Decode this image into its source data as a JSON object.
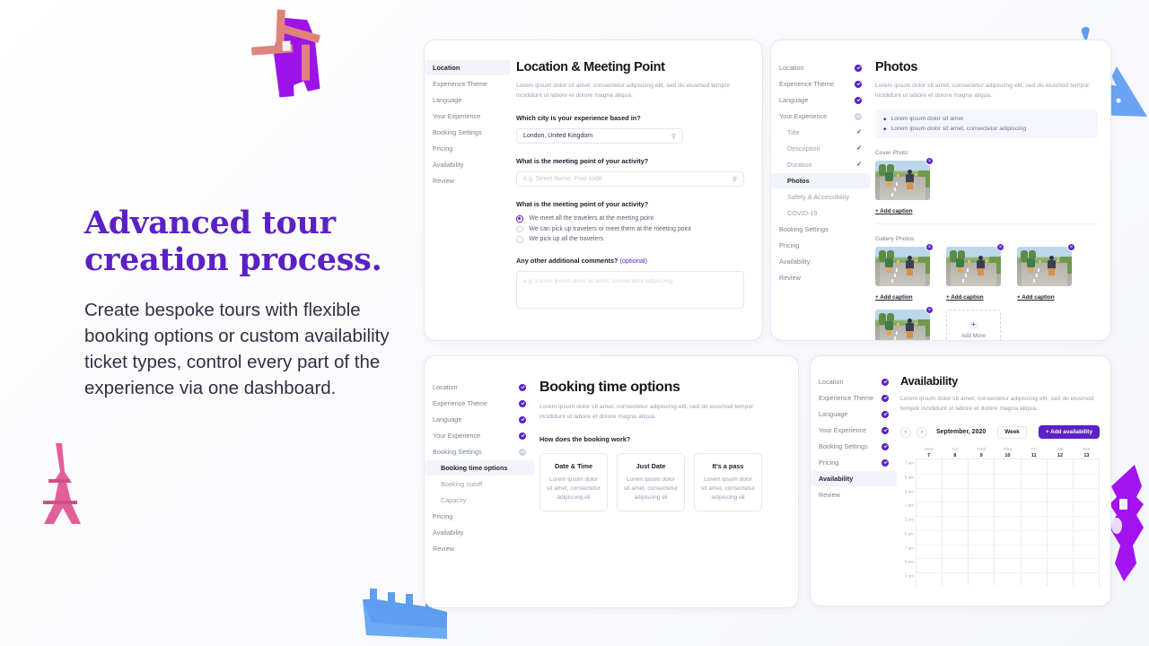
{
  "hero": {
    "headline_line1": "Advanced tour",
    "headline_line2": "creation process.",
    "body": "Create bespoke tours with flexible booking options or custom availability ticket types, control every part of the experience via one dashboard.",
    "headline_color": "#5b21c4"
  },
  "theme": {
    "accent": "#5b21c4",
    "nav_active_bg": "#f1f4fa",
    "card_border": "#e3e8f2"
  },
  "decor": [
    {
      "name": "windmill",
      "colors": [
        "#9b13e8",
        "#e0827e"
      ]
    },
    {
      "name": "eiffel-tower",
      "colors": [
        "#e0609a",
        "#c94f86"
      ]
    },
    {
      "name": "great-wall",
      "colors": [
        "#5d9ef0",
        "#79b4f7"
      ]
    },
    {
      "name": "pyramid",
      "colors": [
        "#6aa3f2"
      ]
    },
    {
      "name": "tower",
      "colors": [
        "#a312f0"
      ]
    },
    {
      "name": "map-pin",
      "colors": [
        "#5d9ef0"
      ]
    }
  ],
  "card_location": {
    "nav": [
      {
        "label": "Location",
        "state": "active"
      },
      {
        "label": "Experience Theme",
        "state": "idle"
      },
      {
        "label": "Language",
        "state": "idle"
      },
      {
        "label": "Your Experience",
        "state": "idle"
      },
      {
        "label": "Booking Settings",
        "state": "idle"
      },
      {
        "label": "Pricing",
        "state": "idle"
      },
      {
        "label": "Availability",
        "state": "idle"
      },
      {
        "label": "Review",
        "state": "idle"
      }
    ],
    "title": "Location & Meeting Point",
    "lede": "Lorem ipsum dolor sit amet, consectetur adipiscing elit, sed do eiusmod tempor incididunt ut labore et dolore magna aliqua.",
    "q_city": "Which city is your experience based in?",
    "city_value": "London, United Kingdom",
    "q_meeting_field": "What is the meeting point of your activity?",
    "meeting_placeholder": "e.g. Street Name, Post code",
    "q_meeting_radio": "What is the meeting point of your activity?",
    "radio_options": [
      {
        "label": "We meet all the travelers at the meeting point",
        "selected": true
      },
      {
        "label": "We can pick up travelers or meet them at the meeting point",
        "selected": false
      },
      {
        "label": "We pick up all the travelers",
        "selected": false
      }
    ],
    "q_comments": "Any other additional comments?",
    "q_comments_optional": "(optional)",
    "comments_placeholder": "e.g. Lorem ipsum dolor sit amet, consectetur adipiscing",
    "search_icon": "magnifier-icon"
  },
  "card_photos": {
    "nav": [
      {
        "label": "Location",
        "state": "done",
        "sub": false
      },
      {
        "label": "Experience Theme",
        "state": "done",
        "sub": false
      },
      {
        "label": "Language",
        "state": "done",
        "sub": false
      },
      {
        "label": "Your Experience",
        "state": "partial",
        "sub": false
      },
      {
        "label": "Title",
        "state": "tick",
        "sub": true
      },
      {
        "label": "Description",
        "state": "tick",
        "sub": true
      },
      {
        "label": "Duration",
        "state": "tick",
        "sub": true
      },
      {
        "label": "Photos",
        "state": "active",
        "sub": true
      },
      {
        "label": "Safety & Accessibility",
        "state": "idle",
        "sub": true
      },
      {
        "label": "COVID-19",
        "state": "idle",
        "sub": true
      },
      {
        "label": "Booking Settings",
        "state": "idle",
        "sub": false
      },
      {
        "label": "Pricing",
        "state": "idle",
        "sub": false
      },
      {
        "label": "Availability",
        "state": "idle",
        "sub": false
      },
      {
        "label": "Review",
        "state": "idle",
        "sub": false
      }
    ],
    "title": "Photos",
    "lede": "Lorem ipsum dolor sit amet, consectetur adipiscing elit, sed do eiusmod tempor incididunt ut labore et dolore magna aliqua.",
    "notes": [
      "Lorem ipsum dolor sit amet",
      "Lorem ipsum dolor sit amet, consectetur adipiscing"
    ],
    "cover_label": "Cover Photo",
    "gallery_label": "Gallery Photos",
    "add_caption": "+ Add caption",
    "add_more": "Add More",
    "add_more_plus": "+",
    "delete_badge": "×",
    "gallery_count": 4
  },
  "card_booking": {
    "nav": [
      {
        "label": "Location",
        "state": "done",
        "sub": false
      },
      {
        "label": "Experience Theme",
        "state": "done",
        "sub": false
      },
      {
        "label": "Language",
        "state": "done",
        "sub": false
      },
      {
        "label": "Your Experience",
        "state": "done",
        "sub": false
      },
      {
        "label": "Booking Settings",
        "state": "partial",
        "sub": false
      },
      {
        "label": "Booking time options",
        "state": "active",
        "sub": true
      },
      {
        "label": "Booking cutoff",
        "state": "idle",
        "sub": true
      },
      {
        "label": "Capacity",
        "state": "idle",
        "sub": true
      },
      {
        "label": "Pricing",
        "state": "idle",
        "sub": false
      },
      {
        "label": "Availability",
        "state": "idle",
        "sub": false
      },
      {
        "label": "Review",
        "state": "idle",
        "sub": false
      }
    ],
    "title": "Booking time options",
    "lede": "Lorem ipsum dolor sit amet, consectetur adipiscing elit, sed do eiusmod tempor incididunt ut labore et dolore magna aliqua.",
    "question": "How does the booking work?",
    "options": [
      {
        "title": "Date & Time",
        "desc": "Lorem ipsum dolor sit amet, consectetur adipiscing eli"
      },
      {
        "title": "Just Date",
        "desc": "Lorem ipsum dolor sit amet, consectetur adipiscing eli"
      },
      {
        "title": "It's a pass",
        "desc": "Lorem ipsum dolor sit amet, consectetur adipiscing eli"
      }
    ]
  },
  "card_availability": {
    "nav": [
      {
        "label": "Location",
        "state": "done",
        "sub": false
      },
      {
        "label": "Experience Theme",
        "state": "done",
        "sub": false
      },
      {
        "label": "Language",
        "state": "done",
        "sub": false
      },
      {
        "label": "Your Experience",
        "state": "done",
        "sub": false
      },
      {
        "label": "Booking Settings",
        "state": "done",
        "sub": false
      },
      {
        "label": "Pricing",
        "state": "done",
        "sub": false
      },
      {
        "label": "Availability",
        "state": "active",
        "sub": false
      },
      {
        "label": "Review",
        "state": "idle",
        "sub": false
      }
    ],
    "title": "Availability",
    "lede": "Lorem ipsum dolor sit amet, consectetur adipiscing elit, sed do eiusmod tempor incididunt ut labore et dolore magna aliqua.",
    "prev_icon": "‹",
    "next_icon": "›",
    "month": "September, 2020",
    "view": "Week",
    "add_button": "+ Add availability",
    "days": [
      {
        "dow": "Mon",
        "num": "7"
      },
      {
        "dow": "Tue",
        "num": "8"
      },
      {
        "dow": "Wed",
        "num": "9"
      },
      {
        "dow": "Thur",
        "num": "10"
      },
      {
        "dow": "Fri",
        "num": "11"
      },
      {
        "dow": "Sat",
        "num": "12"
      },
      {
        "dow": "Sun",
        "num": "13"
      }
    ],
    "times": [
      "7 am",
      "8 am",
      "9 am",
      "1 pm",
      "5 pm",
      "6 pm",
      "7 pm",
      "8 pm",
      "9 pm"
    ]
  }
}
